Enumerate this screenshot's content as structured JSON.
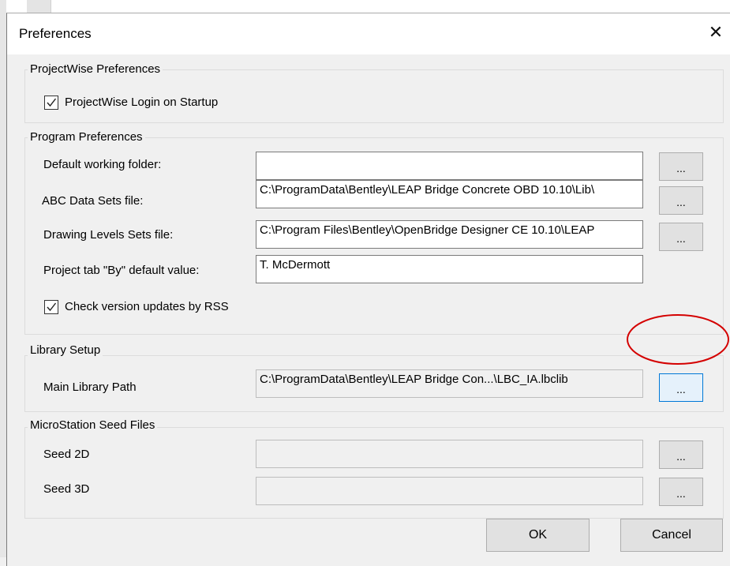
{
  "dialog": {
    "title": "Preferences",
    "close_symbol": "✕"
  },
  "projectwise": {
    "group_title": "ProjectWise Preferences",
    "login_on_startup": {
      "label": "ProjectWise Login on Startup",
      "checked": true
    }
  },
  "program": {
    "group_title": "Program Preferences",
    "default_working_folder": {
      "label": "Default working folder:",
      "value": ""
    },
    "abc_data_sets_file": {
      "label": "ABC Data Sets file:",
      "value": "C:\\ProgramData\\Bentley\\LEAP Bridge Concrete OBD 10.10\\Lib\\"
    },
    "drawing_levels_sets_file": {
      "label": "Drawing Levels Sets file:",
      "value": "C:\\Program Files\\Bentley\\OpenBridge Designer CE 10.10\\LEAP"
    },
    "project_tab_by": {
      "label": "Project tab \"By\" default value:",
      "value": "T. McDermott"
    },
    "check_version_updates": {
      "label": "Check version updates by RSS",
      "checked": true
    },
    "browse_label": "..."
  },
  "library": {
    "group_title": "Library Setup",
    "main_library_path": {
      "label": "Main Library Path",
      "value": "C:\\ProgramData\\Bentley\\LEAP Bridge Con...\\LBC_IA.lbclib"
    },
    "browse_label": "..."
  },
  "microstation": {
    "group_title": "MicroStation Seed Files",
    "seed_2d": {
      "label": "Seed 2D",
      "value": ""
    },
    "seed_3d": {
      "label": "Seed 3D",
      "value": ""
    },
    "browse_label": "..."
  },
  "buttons": {
    "ok": "OK",
    "cancel": "Cancel"
  },
  "colors": {
    "annotation_red": "#d40000",
    "focus_blue": "#0078d7"
  }
}
